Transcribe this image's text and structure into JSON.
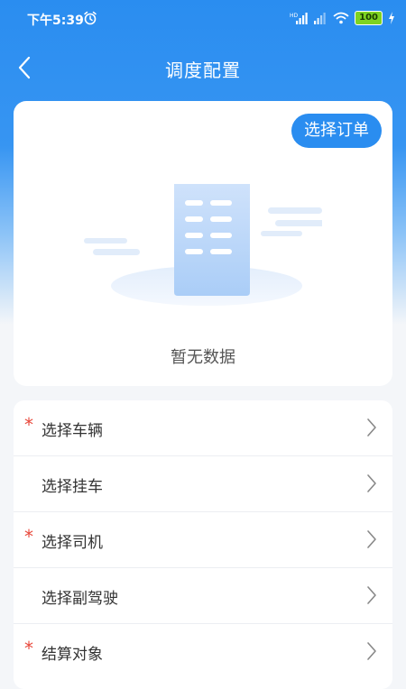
{
  "status_bar": {
    "time": "下午5:39",
    "battery": "100",
    "icons": [
      "alarm-icon",
      "hd-signal-icon",
      "signal-icon",
      "wifi-icon",
      "battery-icon",
      "charging-icon"
    ]
  },
  "nav": {
    "title": "调度配置",
    "back_icon": "chevron-left-icon"
  },
  "order_card": {
    "select_order_label": "选择订单",
    "empty_text": "暂无数据",
    "illustration": "empty-document-icon"
  },
  "form": {
    "rows": [
      {
        "label": "选择车辆",
        "required": true
      },
      {
        "label": "选择挂车",
        "required": false
      },
      {
        "label": "选择司机",
        "required": true
      },
      {
        "label": "选择副驾驶",
        "required": false
      },
      {
        "label": "结算对象",
        "required": true
      }
    ],
    "required_mark": "*",
    "chevron_icon": "chevron-right-icon"
  },
  "colors": {
    "primary": "#2a8df0",
    "required": "#e8483b",
    "background": "#f4f6f9"
  }
}
